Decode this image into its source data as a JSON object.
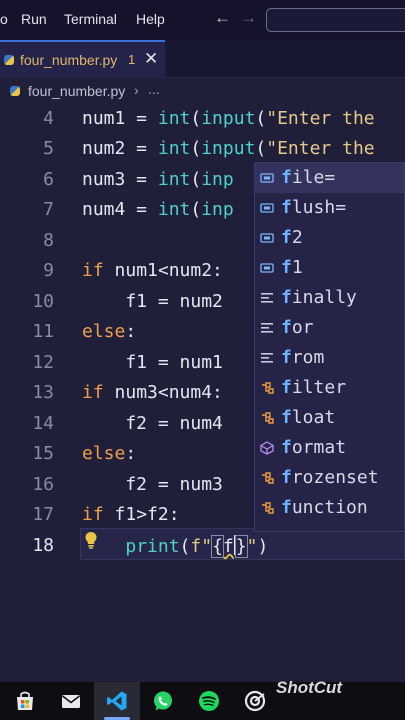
{
  "menubar": {
    "items": [
      {
        "label": "o"
      },
      {
        "label": "Run"
      },
      {
        "label": "Terminal"
      },
      {
        "label": "Help"
      }
    ],
    "back_glyph": "←",
    "forward_glyph": "→"
  },
  "tab": {
    "label": "four_number.py",
    "badge": "1",
    "close_glyph": "✕"
  },
  "breadcrumb": {
    "file": "four_number.py",
    "separator": "›",
    "more": "..."
  },
  "editor": {
    "line_numbers": [
      "4",
      "5",
      "6",
      "7",
      "8",
      "9",
      "10",
      "11",
      "12",
      "13",
      "14",
      "15",
      "16",
      "17",
      "18"
    ],
    "active_line": "18",
    "code": {
      "l4": {
        "var": "num1 = ",
        "call1": "int",
        "p1": "(",
        "call2": "input",
        "p2": "(",
        "str": "\"Enter the"
      },
      "l5": {
        "var": "num2 = ",
        "call1": "int",
        "p1": "(",
        "call2": "input",
        "p2": "(",
        "str": "\"Enter the"
      },
      "l6": {
        "var": "num3 = ",
        "call1": "int",
        "p1": "(",
        "call2": "inp"
      },
      "l7": {
        "var": "num4 = ",
        "call1": "int",
        "p1": "(",
        "call2": "inp"
      },
      "l9": {
        "kw": "if",
        "rest": " num1<num2:"
      },
      "l10": {
        "text": "    f1 = num2"
      },
      "l11": {
        "kw": "else",
        "rest": ":"
      },
      "l12": {
        "text": "    f1 = num1"
      },
      "l13": {
        "kw": "if",
        "rest": " num3<num4:"
      },
      "l14": {
        "text": "    f2 = num4"
      },
      "l15": {
        "kw": "else",
        "rest": ":"
      },
      "l16": {
        "text": "    f2 = num3"
      },
      "l17": {
        "kw": "if",
        "rest": " f1>f2:"
      },
      "l18": {
        "indent": "    ",
        "call": "print",
        "p1": "(",
        "prefix": "f",
        "q1": "\"",
        "b1": "{",
        "typed": "f",
        "b2": "}",
        "q2": "\"",
        "p2": ")"
      }
    }
  },
  "suggestions": {
    "items": [
      {
        "match": "f",
        "rest": "ile=",
        "kind": "variable"
      },
      {
        "match": "f",
        "rest": "lush=",
        "kind": "variable"
      },
      {
        "match": "f",
        "rest": "2",
        "kind": "variable"
      },
      {
        "match": "f",
        "rest": "1",
        "kind": "variable"
      },
      {
        "match": "f",
        "rest": "inally",
        "kind": "keyword"
      },
      {
        "match": "f",
        "rest": "or",
        "kind": "keyword"
      },
      {
        "match": "f",
        "rest": "rom",
        "kind": "keyword"
      },
      {
        "match": "f",
        "rest": "ilter",
        "kind": "class"
      },
      {
        "match": "f",
        "rest": "loat",
        "kind": "class"
      },
      {
        "match": "f",
        "rest": "ormat",
        "kind": "function"
      },
      {
        "match": "f",
        "rest": "rozenset",
        "kind": "class"
      },
      {
        "match": "f",
        "rest": "unction",
        "kind": "class"
      }
    ]
  },
  "taskbar": {
    "apps": [
      "store-icon",
      "mail-icon",
      "vscode-icon",
      "whatsapp-icon",
      "spotify-icon",
      "target-icon"
    ],
    "watermark": "ShotCut"
  },
  "colors": {
    "keyword": "#f29e4c",
    "function": "#4fd1c5",
    "string": "#e6c88a",
    "match_highlight": "#6fb2ff",
    "accent": "#3a74d8"
  }
}
